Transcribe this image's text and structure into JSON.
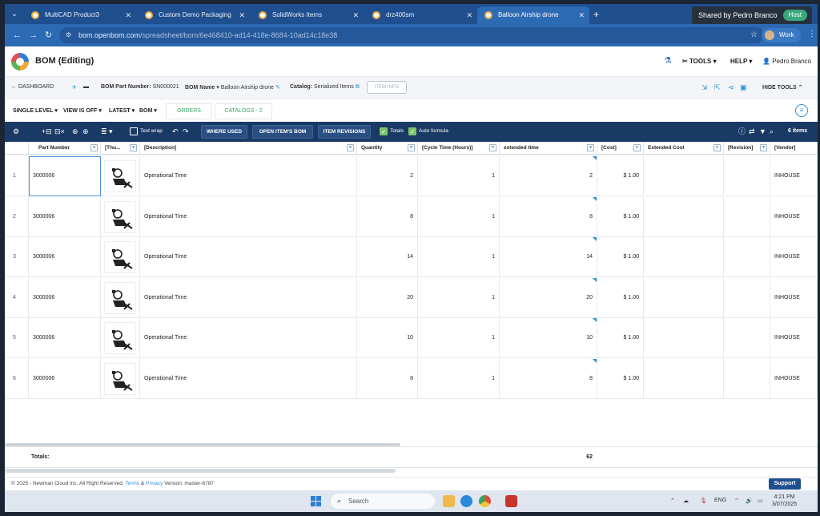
{
  "browser": {
    "tabs": [
      {
        "label": "MultiCAD Product3",
        "active": false
      },
      {
        "label": "Custom Demo Packaging",
        "active": false
      },
      {
        "label": "SolidWorks Items",
        "active": false
      },
      {
        "label": "drz400sm",
        "active": false
      },
      {
        "label": "Balloon Airship drone",
        "active": true
      }
    ],
    "share_label": "Shared by Pedro Branco",
    "host_label": "Host",
    "url_host": "bom.openbom.com",
    "url_path": "/spreadsheet/bom/6e468410-ad14-418e-8684-10ad14c18e38",
    "profile_label": "Work"
  },
  "app": {
    "title": "BOM (Editing)",
    "tools_label": "TOOLS",
    "help_label": "HELP",
    "user_name": "Pedro Branco"
  },
  "crumbs": {
    "dashboard": "DASHBOARD",
    "part_number_label": "BOM Part Number:",
    "part_number_value": "SN000021",
    "bom_name_label": "BOM Name",
    "bom_name_value": "Balloon Airship drone",
    "catalog_label": "Catalog:",
    "catalog_value": "Serialized Items",
    "item_info": "ITEM INFO",
    "hide_tools": "HIDE TOOLS"
  },
  "levelbar": {
    "single_level": "SINGLE LEVEL",
    "view": "VIEW IS OFF",
    "latest": "LATEST",
    "bom": "BOM",
    "orders": "ORDERS",
    "catalogs": "CATALOGS - 2"
  },
  "toolbar": {
    "text_wrap": "Text wrap",
    "where_used": "WHERE USED",
    "open_items_bom": "OPEN ITEM'S BOM",
    "item_revisions": "ITEM REVISIONS",
    "totals": "Totals",
    "auto_formula": "Auto formula",
    "items_count": "6 items"
  },
  "grid": {
    "columns": [
      "Part Number",
      "[Thu...",
      "[Description]",
      "Quantity",
      "[Cycle Time (Hours)]",
      "extended time",
      "[Cost]",
      "Extended Cost",
      "[Revision]",
      "[Vendor]"
    ],
    "rows": [
      {
        "idx": "1",
        "part": "3000006",
        "desc": "Operational Time",
        "qty": "2",
        "cycle": "1",
        "ext": "2",
        "cost": "$ 1.00",
        "vendor": "INHOUSE"
      },
      {
        "idx": "2",
        "part": "3000006",
        "desc": "Operational Time",
        "qty": "8",
        "cycle": "1",
        "ext": "8",
        "cost": "$ 1.00",
        "vendor": "INHOUSE"
      },
      {
        "idx": "3",
        "part": "3000006",
        "desc": "Operational Time",
        "qty": "14",
        "cycle": "1",
        "ext": "14",
        "cost": "$ 1.00",
        "vendor": "INHOUSE"
      },
      {
        "idx": "4",
        "part": "3000006",
        "desc": "Operational Time",
        "qty": "20",
        "cycle": "1",
        "ext": "20",
        "cost": "$ 1.00",
        "vendor": "INHOUSE"
      },
      {
        "idx": "5",
        "part": "3000006",
        "desc": "Operational Time",
        "qty": "10",
        "cycle": "1",
        "ext": "10",
        "cost": "$ 1.00",
        "vendor": "INHOUSE"
      },
      {
        "idx": "6",
        "part": "3000006",
        "desc": "Operational Time",
        "qty": "8",
        "cycle": "1",
        "ext": "8",
        "cost": "$ 1.00",
        "vendor": "INHOUSE"
      }
    ],
    "totals_label": "Totals:",
    "totals_ext": "62"
  },
  "footer": {
    "copyright": "© 2025 - Newman Cloud Inc. All Right Reserved.",
    "terms": "Terms",
    "amp": "&",
    "privacy": "Privacy",
    "version": "Version: master-6787",
    "support": "Support"
  },
  "taskbar": {
    "search_placeholder": "Search",
    "lang": "ENG",
    "time": "4:21 PM",
    "date": "3/07/2025"
  },
  "colors": {
    "browser_tabbar": "#1f4f8f",
    "toolbar": "#1a3a66",
    "accent": "#2c8fd6",
    "green": "#3aa365"
  }
}
